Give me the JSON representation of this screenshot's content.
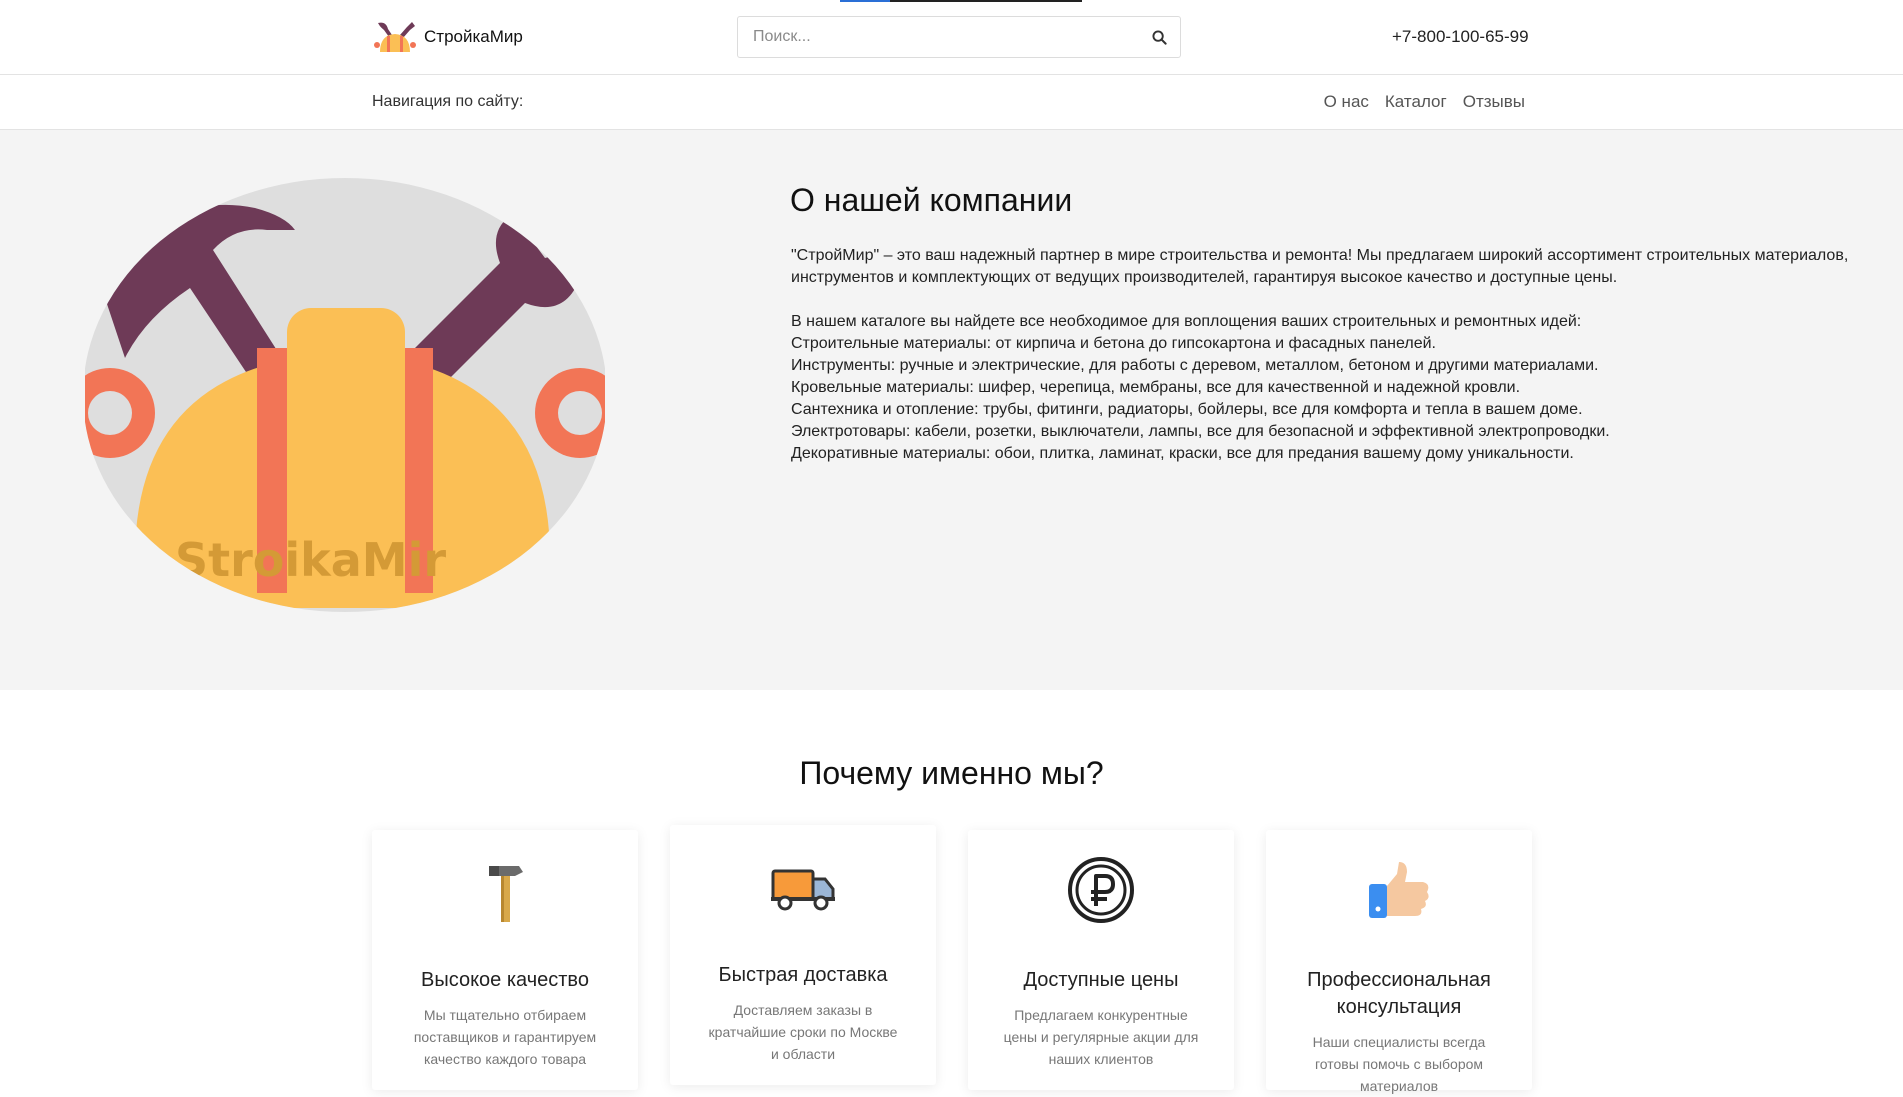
{
  "header": {
    "logo_text": "СтройкаМир",
    "search_placeholder": "Поиск...",
    "phone": "+7-800-100-65-99"
  },
  "nav": {
    "label": "Навигация по сайту:",
    "links": [
      "О нас",
      "Каталог",
      "Отзывы"
    ]
  },
  "about": {
    "title": "О нашей компании",
    "image_watermark": "StroikaMir",
    "intro": "\"СтройМир\" – это ваш надежный партнер в мире строительства и ремонта! Мы предлагаем широкий ассортимент строительных материалов, инструментов и комплектующих от ведущих производителей, гарантируя высокое качество и доступные цены.",
    "catalog_intro": "В нашем каталоге вы найдете все необходимое для воплощения ваших строительных и ремонтных идей:",
    "items": [
      "Строительные материалы: от кирпича и бетона до гипсокартона и фасадных панелей.",
      "Инструменты: ручные и электрические, для работы с деревом, металлом, бетоном и другими материалами.",
      "Кровельные материалы: шифер, черепица, мембраны, все для качественной и надежной кровли.",
      "Сантехника и отопление: трубы, фитинги, радиаторы, бойлеры, все для комфорта и тепла в вашем доме.",
      "Электротовары: кабели, розетки, выключатели, лампы, все для безопасной и эффективной электропроводки.",
      "Декоративные материалы: обои, плитка, ламинат, краски, все для предания вашему дому уникальности."
    ]
  },
  "why": {
    "title": "Почему именно мы?",
    "cards": [
      {
        "icon": "hammer-icon",
        "title": "Высокое качество",
        "text": "Мы тщательно отбираем поставщиков и гарантируем качество каждого товара"
      },
      {
        "icon": "truck-icon",
        "title": "Быстрая доставка",
        "text": "Доставляем заказы в кратчайшие сроки по Москве и области"
      },
      {
        "icon": "ruble-icon",
        "title": "Доступные цены",
        "text": "Предлагаем конкурентные цены и регулярные акции для наших клиентов"
      },
      {
        "icon": "thumbs-up-icon",
        "title": "Профессиональная консультация",
        "text": "Наши специалисты всегда готовы помочь с выбором материалов"
      }
    ]
  }
}
